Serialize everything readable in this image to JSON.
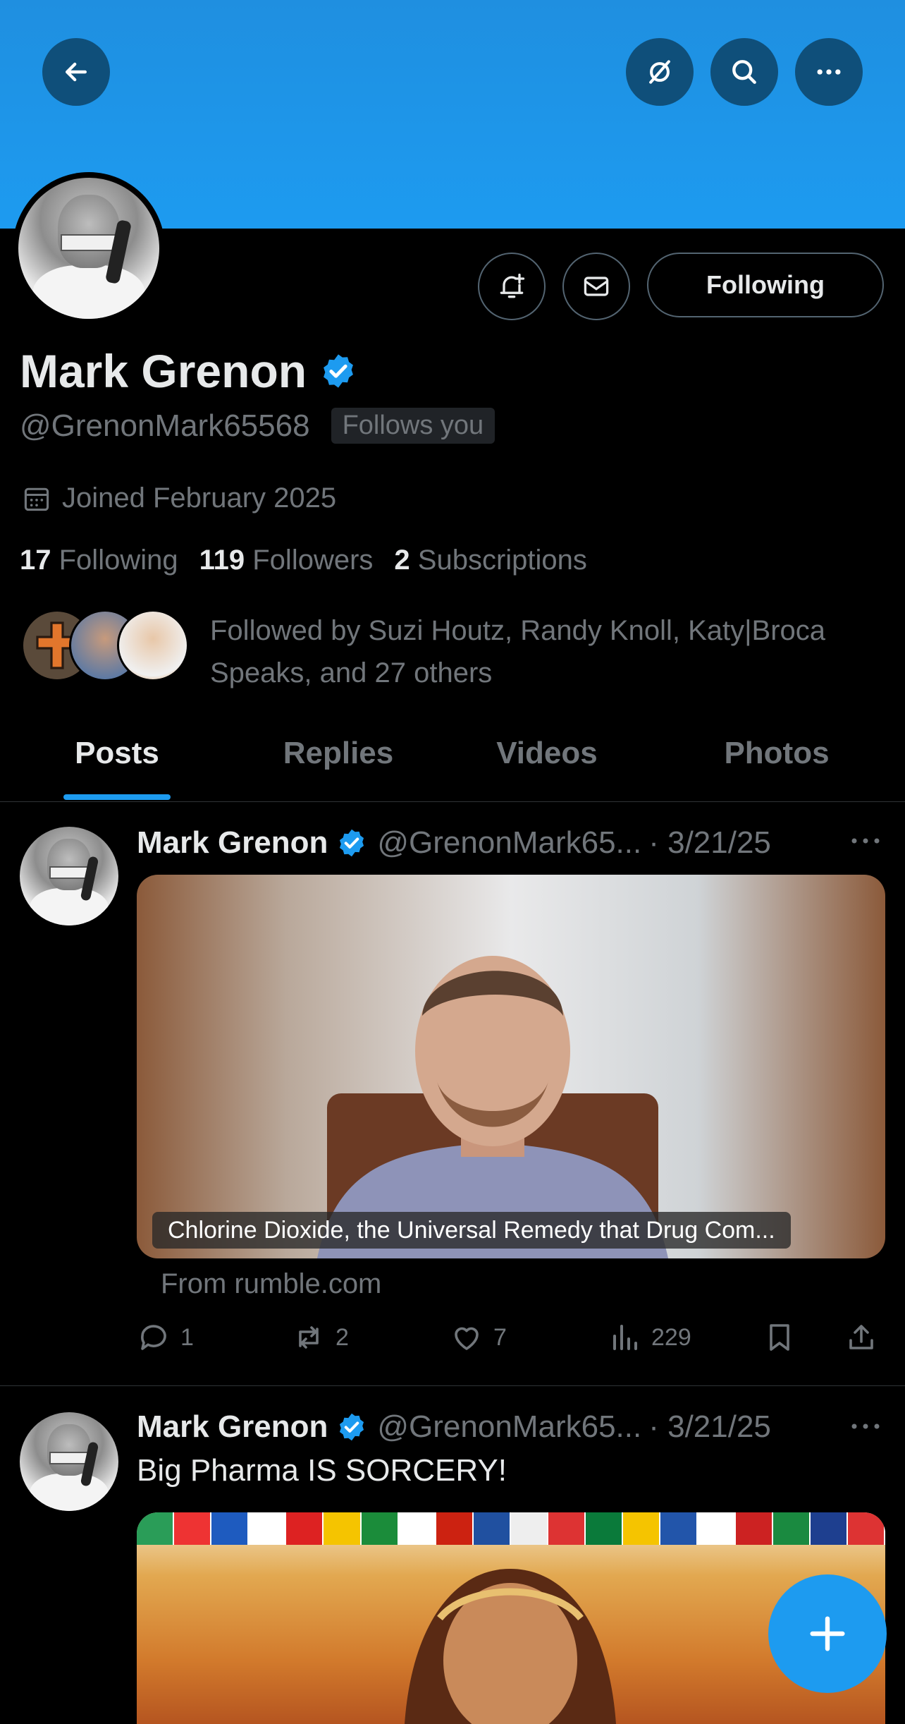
{
  "profile": {
    "name": "Mark Grenon",
    "handle": "@GrenonMark65568",
    "follows_you": "Follows you",
    "joined": "Joined February 2025",
    "following_count": "17",
    "following_label": "Following",
    "followers_count": "119",
    "followers_label": "Followers",
    "subscriptions_count": "2",
    "subscriptions_label": "Subscriptions",
    "followed_by": "Followed by Suzi Houtz, Randy Knoll, Katy|Broca Speaks, and 27 others",
    "following_button": "Following"
  },
  "tabs": [
    {
      "label": "Posts",
      "active": true
    },
    {
      "label": "Replies",
      "active": false
    },
    {
      "label": "Videos",
      "active": false
    },
    {
      "label": "Photos",
      "active": false
    }
  ],
  "posts": [
    {
      "author": "Mark Grenon",
      "handle": "@GrenonMark65...",
      "date": "· 3/21/25",
      "media_caption": "Chlorine Dioxide, the Universal Remedy that Drug Com...",
      "source": "From rumble.com",
      "replies": "1",
      "reposts": "2",
      "likes": "7",
      "views": "229"
    },
    {
      "author": "Mark Grenon",
      "handle": "@GrenonMark65...",
      "date": "· 3/21/25",
      "text": "Big Pharma IS SORCERY!"
    }
  ],
  "colors": {
    "accent": "#1d9bf0",
    "banner": "#1d9bf0",
    "muted_text": "#71767b",
    "primary_text": "#e7e9ea"
  },
  "icons": [
    "back-arrow-icon",
    "grok-icon",
    "search-icon",
    "more-icon",
    "notification-bell-icon",
    "mail-icon",
    "verified-badge-icon",
    "calendar-icon",
    "reply-icon",
    "repost-icon",
    "like-icon",
    "views-icon",
    "bookmark-icon",
    "share-icon",
    "plus-icon"
  ]
}
